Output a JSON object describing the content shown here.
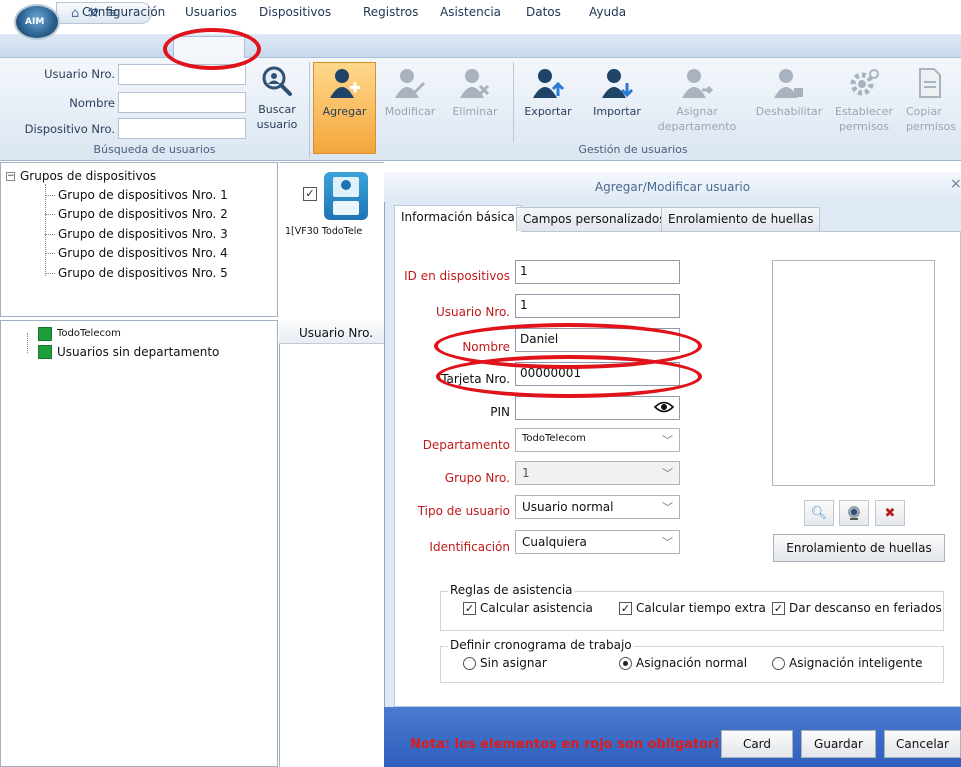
{
  "quick_access": {
    "icons": [
      "home-icon",
      "tools-icon",
      "menu-icon"
    ]
  },
  "menu": {
    "tabs": [
      "Configuración",
      "Usuarios",
      "Dispositivos",
      "Registros",
      "Asistencia",
      "Datos",
      "Ayuda"
    ],
    "active": "Usuarios"
  },
  "search": {
    "user_no_label": "Usuario Nro.",
    "name_label": "Nombre",
    "device_no_label": "Dispositivo Nro.",
    "button": "Buscar usuario",
    "caption": "Búsqueda de usuarios"
  },
  "ribbon": {
    "add": "Agregar",
    "modify": "Modificar",
    "delete": "Eliminar",
    "export": "Exportar",
    "import": "Importar",
    "assign_dept": "Asignar departamento",
    "disable": "Deshabilitar",
    "set_perms": "Establecer permisos",
    "copy_perms": "Copiar permisos",
    "caption": "Gestión de usuarios"
  },
  "device_tree": {
    "root": "Grupos de dispositivos",
    "items": [
      "Grupo de dispositivos Nro. 1",
      "Grupo de dispositivos Nro. 2",
      "Grupo de dispositivos Nro. 3",
      "Grupo de dispositivos Nro. 4",
      "Grupo de dispositivos Nro. 5"
    ]
  },
  "device": {
    "label": "1[VF30 TodoTele"
  },
  "dept_tree": {
    "items": [
      "TodoTelecom",
      "Usuarios sin departamento"
    ]
  },
  "user_list": {
    "column": "Usuario Nro."
  },
  "dialog": {
    "title": "Agregar/Modificar usuario",
    "close": "×",
    "tabs": [
      "Información básica",
      "Campos personalizados",
      "Enrolamiento de huellas"
    ],
    "fields": {
      "device_id": {
        "label": "ID en dispositivos",
        "value": "1"
      },
      "user_no": {
        "label": "Usuario Nro.",
        "value": "1"
      },
      "name": {
        "label": "Nombre",
        "value": "Daniel"
      },
      "card_no": {
        "label": "Tarjeta Nro.",
        "value": "00000001"
      },
      "pin": {
        "label": "PIN",
        "value": ""
      },
      "department": {
        "label": "Departamento",
        "value": "TodoTelecom"
      },
      "group_no": {
        "label": "Grupo Nro.",
        "value": "1"
      },
      "user_type": {
        "label": "Tipo de usuario",
        "value": "Usuario normal"
      },
      "identification": {
        "label": "Identificación",
        "value": "Cualquiera"
      }
    },
    "enroll_button": "Enrolamiento de huellas",
    "attendance_rules": {
      "legend": "Reglas de asistencia",
      "options": [
        "Calcular asistencia",
        "Calcular tiempo extra",
        "Dar descanso en feriados"
      ]
    },
    "schedule": {
      "legend": "Definir cronograma de trabajo",
      "options": [
        "Sin asignar",
        "Asignación normal",
        "Asignación inteligente"
      ],
      "selected": "Asignación normal"
    },
    "note": "Nota: los elementos en rojo son obligatori",
    "buttons": {
      "card": "Card",
      "save": "Guardar",
      "cancel": "Cancelar"
    }
  },
  "colors": {
    "required": "#c01818",
    "annotation": "#e0121a",
    "footer": "#3566c4",
    "dept": "#1e9e3a"
  }
}
